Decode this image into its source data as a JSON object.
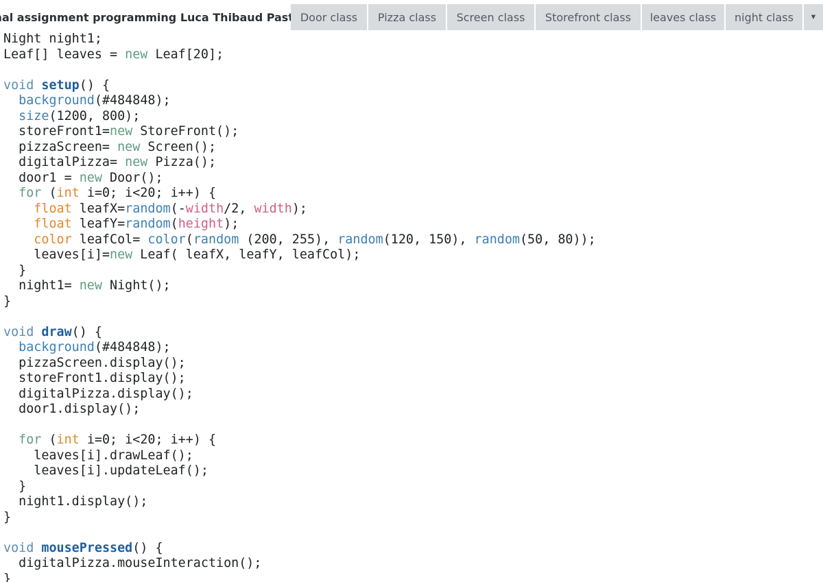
{
  "tabs": [
    {
      "label": "Final assignment programming Luca Thibaud Pastor",
      "active": true
    },
    {
      "label": "Door class"
    },
    {
      "label": "Pizza class"
    },
    {
      "label": "Screen class"
    },
    {
      "label": "Storefront class"
    },
    {
      "label": "leaves class"
    },
    {
      "label": "night class"
    }
  ],
  "tab_menu_icon": "chevron-down-icon",
  "colors": {
    "keyword": "#5d8db0",
    "new_keyword": "#5e9c7e",
    "function_name": "#1f5f9c",
    "builtin": "#3b7fb3",
    "constant": "#d05f86",
    "type": "#e0882c",
    "tab_bg": "#d9dcdf"
  },
  "code_lines": [
    [
      {
        "t": "Night night1;"
      }
    ],
    [
      {
        "t": "Leaf[] leaves = "
      },
      {
        "t": "new",
        "c": "gr"
      },
      {
        "t": " Leaf[20];"
      }
    ],
    [
      {
        "t": ""
      }
    ],
    [
      {
        "t": "void",
        "c": "kw"
      },
      {
        "t": " "
      },
      {
        "t": "setup",
        "c": "fn"
      },
      {
        "t": "() {"
      }
    ],
    [
      {
        "t": "  "
      },
      {
        "t": "background",
        "c": "bi"
      },
      {
        "t": "(#484848);"
      }
    ],
    [
      {
        "t": "  "
      },
      {
        "t": "size",
        "c": "bi"
      },
      {
        "t": "(1200, 800);"
      }
    ],
    [
      {
        "t": "  storeFront1="
      },
      {
        "t": "new",
        "c": "gr"
      },
      {
        "t": " StoreFront();"
      }
    ],
    [
      {
        "t": "  pizzaScreen= "
      },
      {
        "t": "new",
        "c": "gr"
      },
      {
        "t": " Screen();"
      }
    ],
    [
      {
        "t": "  digitalPizza= "
      },
      {
        "t": "new",
        "c": "gr"
      },
      {
        "t": " Pizza();"
      }
    ],
    [
      {
        "t": "  door1 = "
      },
      {
        "t": "new",
        "c": "gr"
      },
      {
        "t": " Door();"
      }
    ],
    [
      {
        "t": "  "
      },
      {
        "t": "for",
        "c": "gr"
      },
      {
        "t": " ("
      },
      {
        "t": "int",
        "c": "ty"
      },
      {
        "t": " i=0; i<20; i++) {"
      }
    ],
    [
      {
        "t": "    "
      },
      {
        "t": "float",
        "c": "ty"
      },
      {
        "t": " leafX="
      },
      {
        "t": "random",
        "c": "bi"
      },
      {
        "t": "(-"
      },
      {
        "t": "width",
        "c": "cv"
      },
      {
        "t": "/2, "
      },
      {
        "t": "width",
        "c": "cv"
      },
      {
        "t": ");"
      }
    ],
    [
      {
        "t": "    "
      },
      {
        "t": "float",
        "c": "ty"
      },
      {
        "t": " leafY="
      },
      {
        "t": "random",
        "c": "bi"
      },
      {
        "t": "("
      },
      {
        "t": "height",
        "c": "cv"
      },
      {
        "t": ");"
      }
    ],
    [
      {
        "t": "    "
      },
      {
        "t": "color",
        "c": "ty"
      },
      {
        "t": " leafCol= "
      },
      {
        "t": "color",
        "c": "bi"
      },
      {
        "t": "("
      },
      {
        "t": "random",
        "c": "bi"
      },
      {
        "t": " (200, 255), "
      },
      {
        "t": "random",
        "c": "bi"
      },
      {
        "t": "(120, 150), "
      },
      {
        "t": "random",
        "c": "bi"
      },
      {
        "t": "(50, 80));"
      }
    ],
    [
      {
        "t": "    leaves[i]="
      },
      {
        "t": "new",
        "c": "gr"
      },
      {
        "t": " Leaf( leafX, leafY, leafCol);"
      }
    ],
    [
      {
        "t": "  }"
      }
    ],
    [
      {
        "t": "  night1= "
      },
      {
        "t": "new",
        "c": "gr"
      },
      {
        "t": " Night();"
      }
    ],
    [
      {
        "t": "}"
      }
    ],
    [
      {
        "t": ""
      }
    ],
    [
      {
        "t": "void",
        "c": "kw"
      },
      {
        "t": " "
      },
      {
        "t": "draw",
        "c": "fn"
      },
      {
        "t": "() {"
      }
    ],
    [
      {
        "t": "  "
      },
      {
        "t": "background",
        "c": "bi"
      },
      {
        "t": "(#484848);"
      }
    ],
    [
      {
        "t": "  pizzaScreen.display();"
      }
    ],
    [
      {
        "t": "  storeFront1.display();"
      }
    ],
    [
      {
        "t": "  digitalPizza.display();"
      }
    ],
    [
      {
        "t": "  door1.display();"
      }
    ],
    [
      {
        "t": ""
      }
    ],
    [
      {
        "t": "  "
      },
      {
        "t": "for",
        "c": "gr"
      },
      {
        "t": " ("
      },
      {
        "t": "int",
        "c": "ty"
      },
      {
        "t": " i=0; i<20; i++) {"
      }
    ],
    [
      {
        "t": "    leaves[i].drawLeaf();"
      }
    ],
    [
      {
        "t": "    leaves[i].updateLeaf();"
      }
    ],
    [
      {
        "t": "  }"
      }
    ],
    [
      {
        "t": "  night1.display();"
      }
    ],
    [
      {
        "t": "}"
      }
    ],
    [
      {
        "t": ""
      }
    ],
    [
      {
        "t": "void",
        "c": "kw"
      },
      {
        "t": " "
      },
      {
        "t": "mousePressed",
        "c": "fn"
      },
      {
        "t": "() {"
      }
    ],
    [
      {
        "t": "  digitalPizza.mouseInteraction();"
      }
    ],
    [
      {
        "t": "}"
      }
    ]
  ]
}
